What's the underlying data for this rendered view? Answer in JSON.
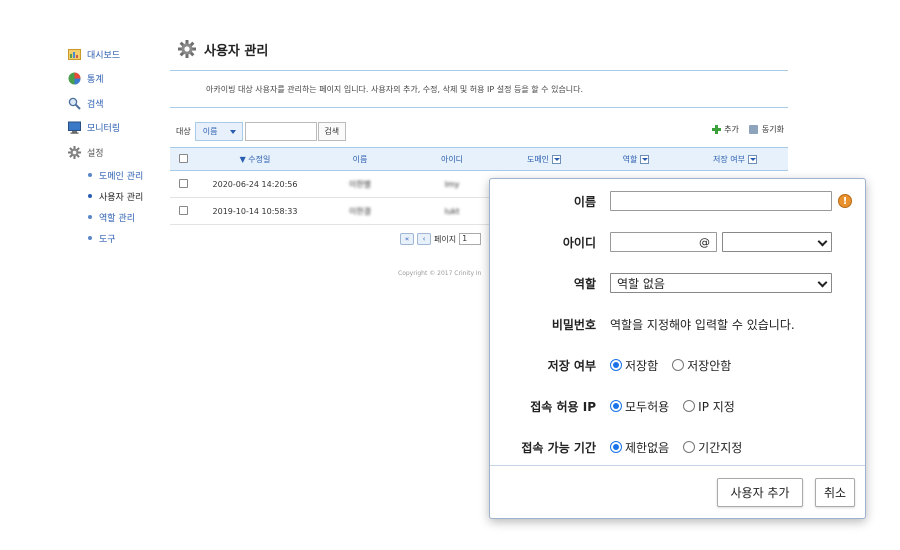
{
  "sidebar": {
    "items": [
      {
        "label": "대시보드",
        "icon": "dashboard-icon"
      },
      {
        "label": "통계",
        "icon": "pie-chart-icon"
      },
      {
        "label": "검색",
        "icon": "search-icon"
      },
      {
        "label": "모니터링",
        "icon": "monitor-icon"
      },
      {
        "label": "설정",
        "icon": "gear-icon"
      }
    ],
    "sub_items": [
      {
        "label": "도메인 관리"
      },
      {
        "label": "사용자 관리",
        "active": true
      },
      {
        "label": "역할 관리"
      },
      {
        "label": "도구"
      }
    ]
  },
  "page": {
    "title": "사용자 관리",
    "description": "아카이빙 대상 사용자를 관리하는 페이지 입니다. 사용자의 추가, 수정, 삭제 및 허용 IP 설정 등을 할 수 있습니다."
  },
  "toolbar": {
    "target_label": "대상",
    "target_value": "이름",
    "search_value": "",
    "search_button": "검색",
    "add_label": "추가",
    "sync_label": "동기화"
  },
  "table": {
    "columns": [
      "수정일",
      "이름",
      "아이디",
      "도메인",
      "역할",
      "저장 여부"
    ],
    "rows": [
      {
        "modified": "2020-06-24 14:20:56",
        "name": "이한별",
        "id": "lmy"
      },
      {
        "modified": "2019-10-14 10:58:33",
        "name": "이한결",
        "id": "lukt"
      }
    ]
  },
  "pager": {
    "page_label": "페이지",
    "page_value": "1"
  },
  "footer": {
    "copyright": "Copyright © 2017 Crinity In"
  },
  "dialog": {
    "fields": {
      "name_label": "이름",
      "name_value": "",
      "id_label": "아이디",
      "id_value": "",
      "at_sign": "@",
      "domain_value": "",
      "role_label": "역할",
      "role_value": "역할 없음",
      "password_label": "비밀번호",
      "password_note": "역할을 지정해야 입력할 수 있습니다.",
      "save_label": "저장 여부",
      "save_on": "저장함",
      "save_off": "저장안함",
      "ip_label": "접속 허용 IP",
      "ip_all": "모두허용",
      "ip_specify": "IP 지정",
      "period_label": "접속 가능 기간",
      "period_unlimited": "제한없음",
      "period_specify": "기간지정"
    },
    "buttons": {
      "add_user": "사용자 추가",
      "cancel": "취소"
    },
    "warning_glyph": "!"
  },
  "colors": {
    "accent": "#2a5db0",
    "header_bg": "#e6f1fb",
    "border": "#a8cbe8",
    "radio_on": "#1a73e8",
    "warning": "#e8912d"
  }
}
